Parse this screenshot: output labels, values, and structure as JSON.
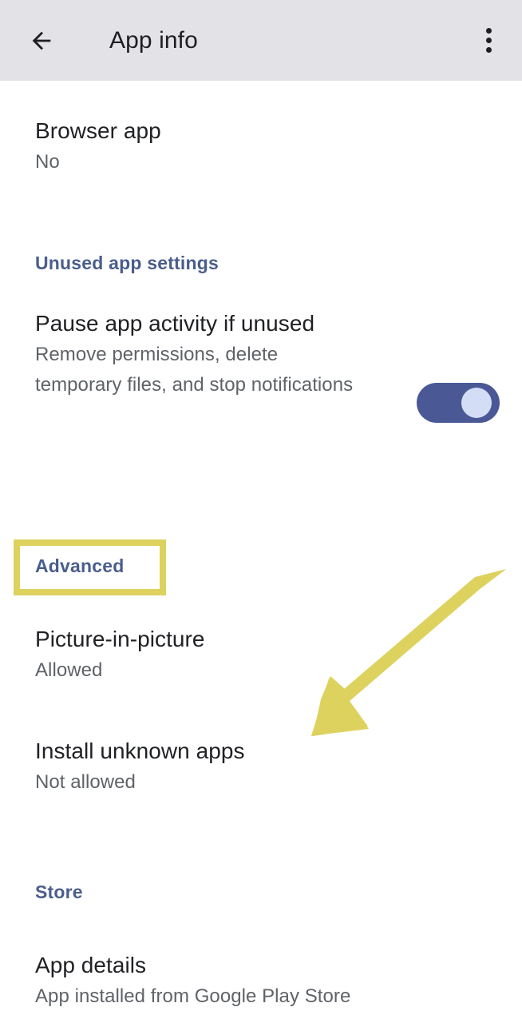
{
  "appbar": {
    "back_icon": "arrow-left-icon",
    "title": "App info",
    "overflow_icon": "more-vertical-icon"
  },
  "settings": {
    "rows": [
      {
        "title": "Browser app",
        "subtitle": "No"
      },
      {
        "title": "Pause app activity if unused",
        "subtitle": "Remove permissions, delete temporary files, and stop notifications",
        "control": "toggle",
        "toggle_state": "on"
      },
      {
        "title": "Picture-in-picture",
        "subtitle": "Allowed"
      },
      {
        "title": "Install unknown apps",
        "subtitle": "Not allowed"
      },
      {
        "title": "App details",
        "subtitle": "App installed from Google Play Store"
      }
    ],
    "section_headers": [
      {
        "label": "Unused app settings"
      },
      {
        "label": "Advanced"
      },
      {
        "label": "Store"
      }
    ]
  },
  "annotations": {
    "highlight_target": "Advanced",
    "arrow_target": "Install unknown apps",
    "color": "#ddd25e"
  },
  "colors": {
    "appbar_bg": "#e3e3e7",
    "page_bg": "#ffffff",
    "title_text": "#202124",
    "subtitle_text": "#5f6368",
    "section_header_blue": "#4a5e8c",
    "toggle_track_on": "#4a5896",
    "toggle_thumb_on": "#d3ddf5",
    "annotation_yellow": "#ddd25e"
  }
}
